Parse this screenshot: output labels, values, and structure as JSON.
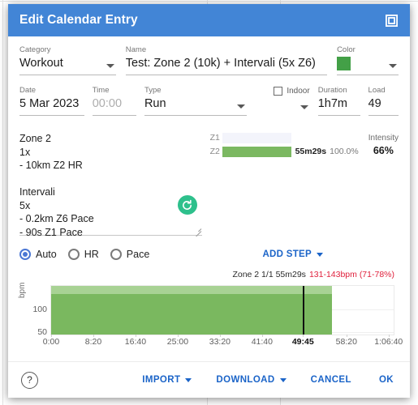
{
  "window": {
    "title": "Edit Calendar Entry",
    "maximize_icon": "maximize-icon",
    "titlebar_color": "#4285d6"
  },
  "form": {
    "category": {
      "label": "Category",
      "value": "Workout"
    },
    "name": {
      "label": "Name",
      "value": "Test: Zone 2 (10k) + Intervali (5x Z6)"
    },
    "color": {
      "label": "Color",
      "value": "#43a047"
    },
    "date": {
      "label": "Date",
      "value": "5 Mar 2023"
    },
    "time": {
      "label": "Time",
      "value": "00:00"
    },
    "type": {
      "label": "Type",
      "value": "Run"
    },
    "indoor": {
      "label": "Indoor",
      "checked": false
    },
    "duration": {
      "label": "Duration",
      "value": "1h7m"
    },
    "load": {
      "label": "Load",
      "value": "49"
    }
  },
  "description": {
    "text": "Zone 2\n1x\n- 10km Z2 HR\n\nIntervali\n5x\n- 0.2km Z6 Pace\n- 90s Z1 Pace",
    "sync_icon": "refresh-icon",
    "resize_handle": "resize-handle"
  },
  "zones": {
    "rows": [
      {
        "name": "Z1",
        "pct_width": 0,
        "time": "",
        "pct": ""
      },
      {
        "name": "Z2",
        "pct_width": 100,
        "time": "55m29s",
        "pct": "100.0%"
      }
    ],
    "intensity": {
      "label": "Intensity",
      "value": "66%"
    }
  },
  "mode": {
    "options": [
      {
        "label": "Auto",
        "selected": true
      },
      {
        "label": "HR",
        "selected": false
      },
      {
        "label": "Pace",
        "selected": false
      }
    ]
  },
  "add_step": {
    "label": "ADD STEP"
  },
  "chart_header": {
    "segment": "Zone 2 1/1 55m29s",
    "hr_range": "131-143bpm (71-78%)",
    "hr_color": "#e0213d"
  },
  "chart_data": {
    "type": "bar",
    "title": "",
    "xlabel": "",
    "ylabel": "bpm",
    "x_tick_labels": [
      "0:00",
      "8:20",
      "16:40",
      "25:00",
      "33:20",
      "41:40",
      "49:45",
      "58:20",
      "1:06:40"
    ],
    "x_tick_seconds": [
      0,
      500,
      1000,
      1500,
      2000,
      2500,
      2985,
      3500,
      4000
    ],
    "x_highlight_label": "49:45",
    "xlim_seconds": [
      0,
      4060
    ],
    "y_tick_labels": [
      "50",
      "100"
    ],
    "y_ticks": [
      50,
      100
    ],
    "ylim": [
      45,
      150
    ],
    "grid": true,
    "legend": false,
    "series": [
      {
        "name": "Zone 2 HR target band",
        "type": "band",
        "color": "#7ab85f",
        "light_color": "#a8d294",
        "x_start_seconds": 0,
        "x_end_seconds": 3329,
        "y_low": 131,
        "y_high": 143
      }
    ],
    "marker": {
      "name": "cursor",
      "x_seconds": 2985,
      "label": "49:45",
      "color": "#101010"
    }
  },
  "footer": {
    "help_icon": "help-icon",
    "buttons": [
      {
        "label": "IMPORT",
        "has_caret": true
      },
      {
        "label": "DOWNLOAD",
        "has_caret": true
      },
      {
        "label": "CANCEL",
        "has_caret": false
      },
      {
        "label": "OK",
        "has_caret": false
      }
    ]
  }
}
